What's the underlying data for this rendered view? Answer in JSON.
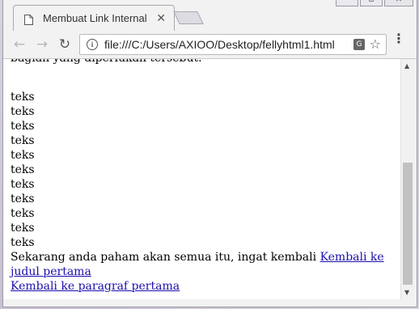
{
  "browser": {
    "tab_title": "Membuat Link Internal",
    "tab_close": "✕",
    "url": "file:///C:/Users/AXIOO/Desktop/fellyhtml1.html",
    "translate_label": "G"
  },
  "page": {
    "cut_text": "bagian yang diperlukan tersebut.",
    "teks_lines": [
      "teks",
      "teks",
      "teks",
      "teks",
      "teks",
      "teks",
      "teks",
      "teks",
      "teks",
      "teks",
      "teks"
    ],
    "paragraph_text": "Sekarang anda paham akan semua itu, ingat kembali ",
    "link1": "Kembali ke judul pertama",
    "link2": "Kembali ke paragraf pertama"
  },
  "scrollbar": {
    "thumb_start_fraction": 0.43,
    "thumb_end_fraction": 0.94
  }
}
